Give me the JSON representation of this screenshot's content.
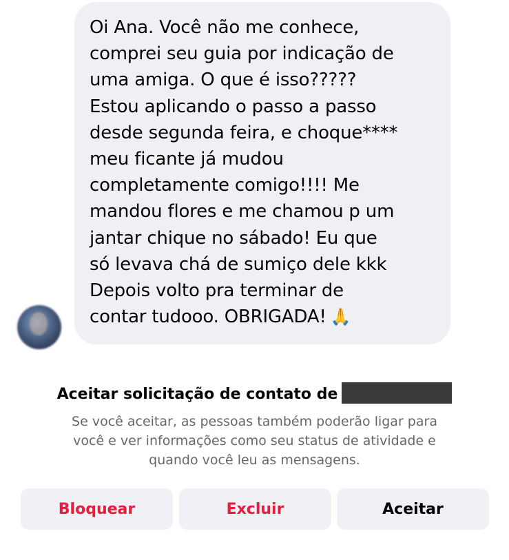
{
  "message": {
    "lines": [
      "Oi Ana. Você não me conhece,",
      "comprei seu guia por indicação de",
      "uma amiga. O que é isso?????",
      "Estou aplicando o passo a passo",
      "desde segunda feira, e choque****",
      "meu ficante já mudou",
      "completamente comigo!!!! Me",
      "mandou flores e me chamou p um",
      "jantar chique no sábado! Eu que",
      "só levava chá de sumiço dele kkk",
      "Depois volto pra terminar de",
      "contar tudooo. OBRIGADA!"
    ],
    "emoji": "🙏",
    "emoji_icon": "folded-hands-icon"
  },
  "request": {
    "title": "Aceitar solicitação de contato de",
    "description_lines": [
      "Se você aceitar, as pessoas também poderão ligar para",
      "você e ver informações como seu status de atividade e",
      "quando você leu as mensagens."
    ]
  },
  "actions": {
    "block_label": "Bloquear",
    "delete_label": "Excluir",
    "accept_label": "Aceitar"
  },
  "colors": {
    "bubble_bg": "#eef0f4",
    "danger": "#e41e3f",
    "secondary_text": "#65676b",
    "button_bg": "#eff1f4"
  }
}
